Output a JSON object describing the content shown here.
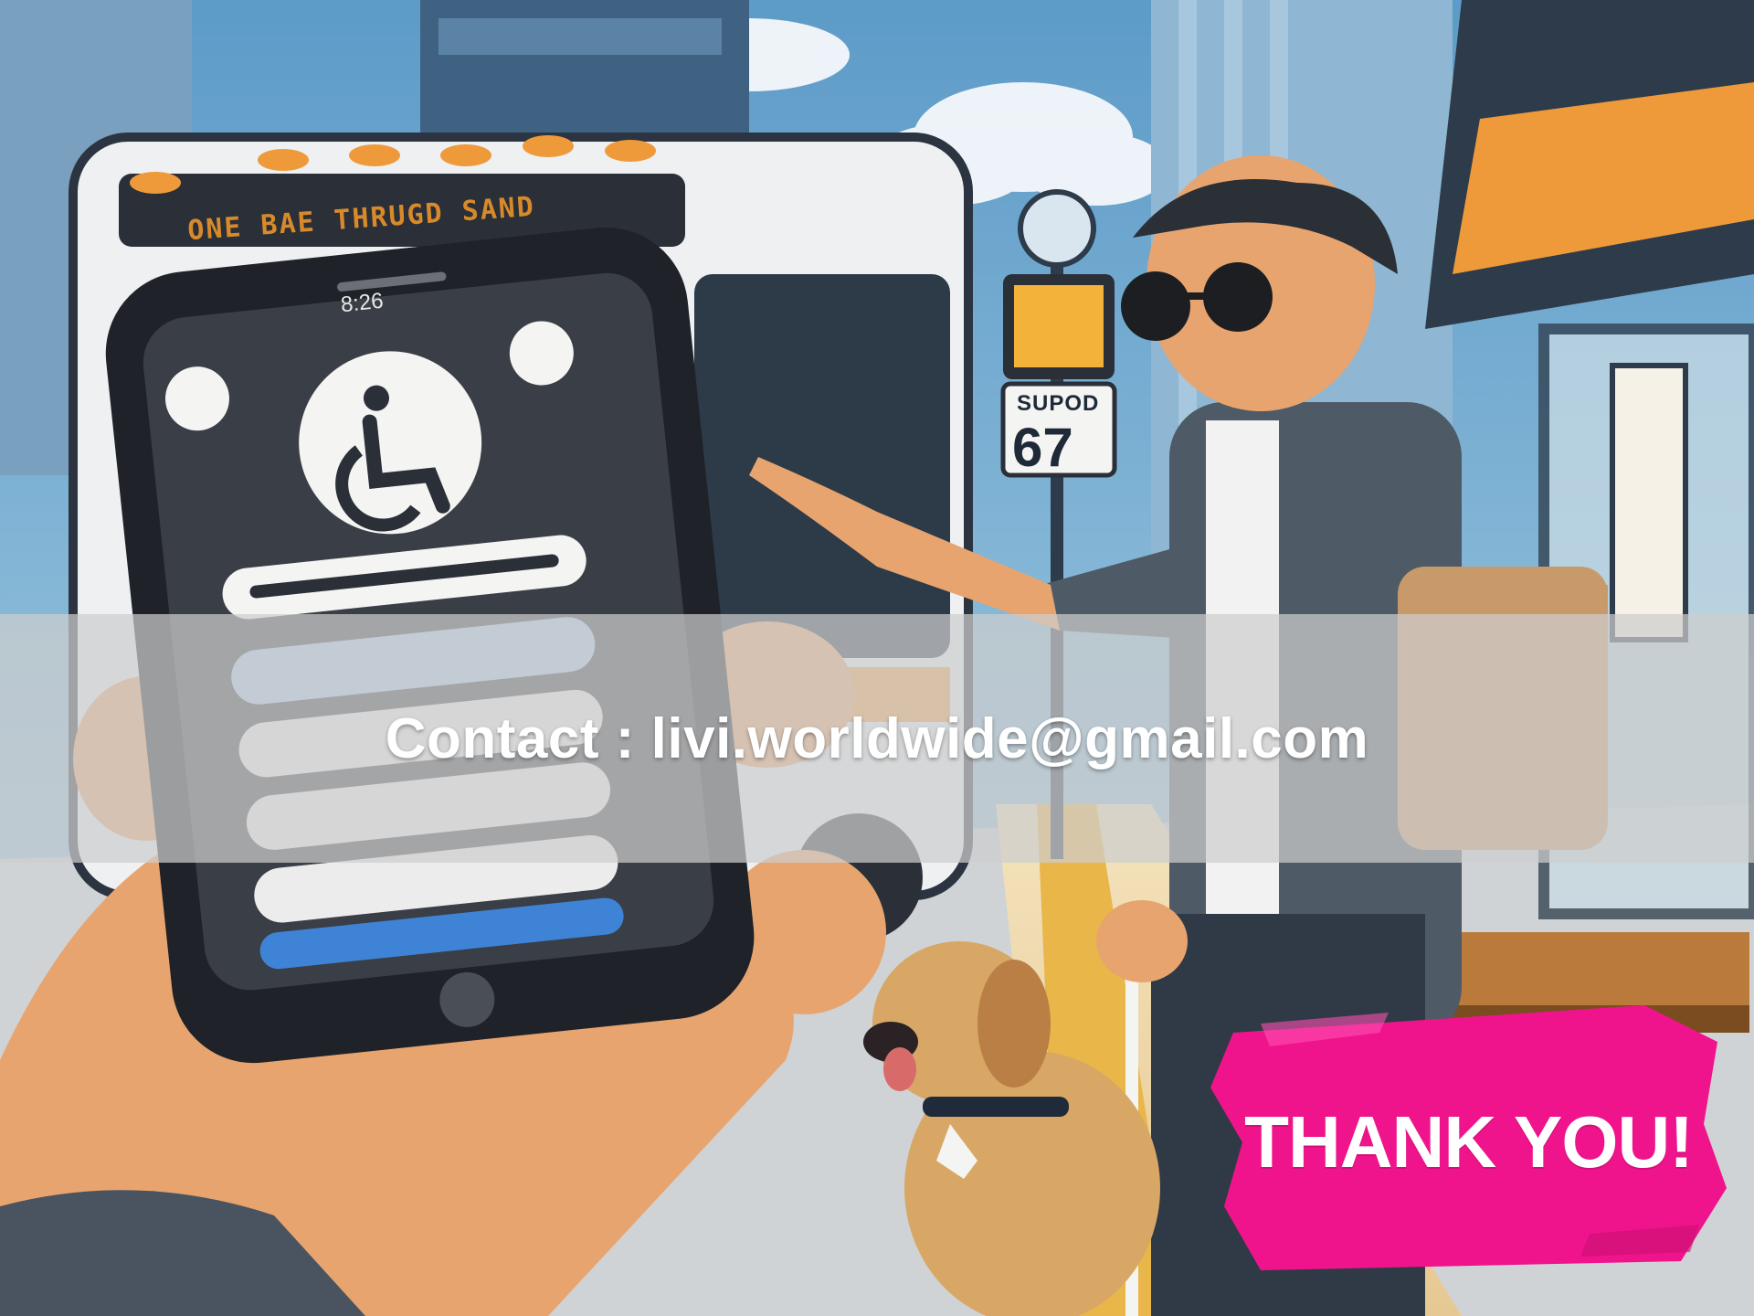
{
  "scene": {
    "bus_marquee": "ONE BAE THRUGD SAND",
    "phone_time": "8:26",
    "sign_top": "SUPOD",
    "sign_number": "67",
    "palette": {
      "sky": "#7fb8d8",
      "skyline": "#4a6f8f",
      "bus_body": "#eef0f2",
      "phone_body": "#1f2228",
      "skin": "#e8a46e",
      "shirt": "#4e5a66",
      "pavement": "#f1d9a6",
      "tactile_strip": "#e9b64a",
      "shelter_roof": "#2d3b4a",
      "dog": "#d8a766",
      "accent_orange": "#ee9a3a"
    }
  },
  "overlay": {
    "contact_label": "Contact",
    "contact_separator": " : ",
    "contact_email": "livi.worldwide@gmail.com"
  },
  "badge": {
    "text": "THANK YOU!",
    "color": "#f0148c"
  }
}
